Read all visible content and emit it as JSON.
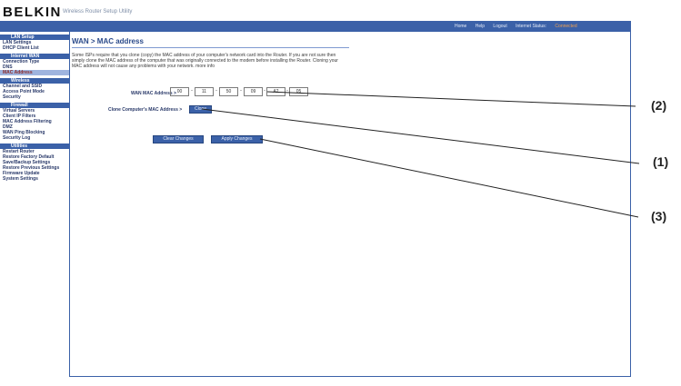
{
  "header": {
    "brand": "BELKIN",
    "tagline": "Wireless Router Setup Utility",
    "links": [
      "Home",
      "Help",
      "Logout",
      "Internet Status:"
    ],
    "internet_status": "Connected"
  },
  "sidebar": {
    "sections": [
      {
        "heading": "LAN Setup",
        "items": [
          "LAN Settings",
          "DHCP Client List"
        ]
      },
      {
        "heading": "Internet WAN",
        "items": [
          "Connection Type",
          "DNS",
          "MAC Address"
        ],
        "active": "MAC Address"
      },
      {
        "heading": "Wireless",
        "items": [
          "Channel and SSID",
          "Access Point Mode",
          "Security"
        ]
      },
      {
        "heading": "Firewall",
        "items": [
          "Virtual Servers",
          "Client IP Filters",
          "MAC Address Filtering",
          "DMZ",
          "WAN Ping Blocking",
          "Security Log"
        ]
      },
      {
        "heading": "Utilities",
        "items": [
          "Restart Router",
          "Restore Factory Default",
          "Save/Backup Settings",
          "Restore Previous Settings",
          "Firmware Update",
          "System Settings"
        ]
      }
    ]
  },
  "main": {
    "title": "WAN > MAC address",
    "description": "Some ISPs require that you clone (copy) the MAC address of your computer's network card into the Router. If you are not sure then simply clone the MAC address of the computer that was originally connected to the modem before installing the Router. Cloning your MAC address will not cause any problems with your network. more info",
    "mac_label": "WAN MAC Address >",
    "mac_octets": [
      "00",
      "11",
      "50",
      "09",
      "A2",
      "05"
    ],
    "clone_label": "Clone Computer's MAC Address >",
    "clone_button": "Clone",
    "clear_button": "Clear Changes",
    "apply_button": "Apply Changes"
  },
  "callouts": [
    "(2)",
    "(1)",
    "(3)"
  ],
  "colors": {
    "accent": "#3b61a8",
    "internet_status": "#f0a050",
    "active_item": "#8a2a2a"
  }
}
